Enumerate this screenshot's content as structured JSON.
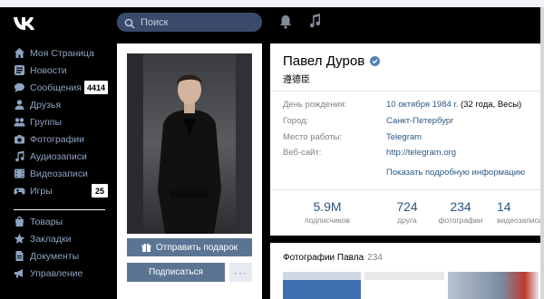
{
  "search": {
    "placeholder": "Поиск"
  },
  "sidebar": {
    "items": [
      {
        "label": "Моя Страница",
        "icon": "home-icon"
      },
      {
        "label": "Новости",
        "icon": "news-icon"
      },
      {
        "label": "Сообщения",
        "icon": "messages-icon",
        "badge": "4414"
      },
      {
        "label": "Друзья",
        "icon": "friends-icon"
      },
      {
        "label": "Группы",
        "icon": "groups-icon"
      },
      {
        "label": "Фотографии",
        "icon": "camera-icon"
      },
      {
        "label": "Аудиозаписи",
        "icon": "music-icon"
      },
      {
        "label": "Видеозаписи",
        "icon": "video-icon"
      },
      {
        "label": "Игры",
        "icon": "gamepad-icon",
        "badge": "25"
      },
      {
        "label": "Товары",
        "icon": "shop-icon"
      },
      {
        "label": "Закладки",
        "icon": "star-icon"
      },
      {
        "label": "Документы",
        "icon": "document-icon"
      },
      {
        "label": "Управление",
        "icon": "megaphone-icon"
      }
    ]
  },
  "profile": {
    "name": "Павел Дуров",
    "status": "遵德臣",
    "gift_button": "Отправить подарок",
    "subscribe_button": "Подписаться",
    "more_button": "···",
    "info": [
      {
        "label": "День рождения:",
        "value": "10 октября 1984 г.",
        "extra": " (32 года, Весы)"
      },
      {
        "label": "Город:",
        "value": "Санкт-Петербург"
      },
      {
        "label": "Место работы:",
        "value": "Telegram"
      },
      {
        "label": "Веб-сайт:",
        "value": "http://telegram.org"
      }
    ],
    "show_more": "Показать подробную информацию",
    "stats": [
      {
        "value": "5.9M",
        "label": "подписчиков"
      },
      {
        "value": "724",
        "label": "друга"
      },
      {
        "value": "234",
        "label": "фотографии"
      },
      {
        "value": "14",
        "label": "видеозаписи"
      }
    ]
  },
  "photos": {
    "title": "Фотографии Павла",
    "count": "234"
  },
  "colors": {
    "accent": "#5b7494",
    "link": "#2a5885",
    "sidebar_text": "#8da3c2"
  }
}
